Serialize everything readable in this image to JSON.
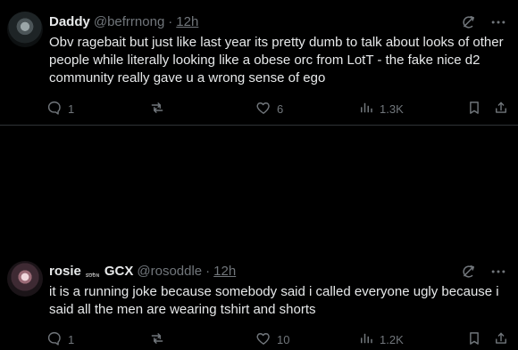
{
  "tweets": [
    {
      "author": {
        "display_name": "Daddy",
        "handle": "@befrrnong"
      },
      "time": "12h",
      "text": "Obv ragebait but just like last year its pretty dumb to talk about looks of other people while literally looking like a obese orc from LotT - the fake nice d2 community really gave u a wrong sense of ego",
      "metrics": {
        "replies": "1",
        "retweets": "",
        "likes": "6",
        "views": "1.3K"
      }
    },
    {
      "author": {
        "display_name": "rosie",
        "name_badge_text": "SOON",
        "display_name_suffix": "GCX",
        "handle": "@rosoddle"
      },
      "time": "12h",
      "text": "it is a running joke because somebody said i called everyone ugly because i said all the men are wearing tshirt and shorts",
      "metrics": {
        "replies": "1",
        "retweets": "",
        "likes": "10",
        "views": "1.2K"
      }
    }
  ],
  "colors": {
    "background": "#000000",
    "text_primary": "#e7e9ea",
    "text_secondary": "#71767b",
    "divider": "#2f3336"
  },
  "icons": {
    "reply": "reply-icon",
    "retweet": "retweet-icon",
    "like": "heart-icon",
    "views": "views-icon",
    "bookmark": "bookmark-icon",
    "share": "share-icon",
    "grok": "grok-icon",
    "more": "more-icon"
  }
}
